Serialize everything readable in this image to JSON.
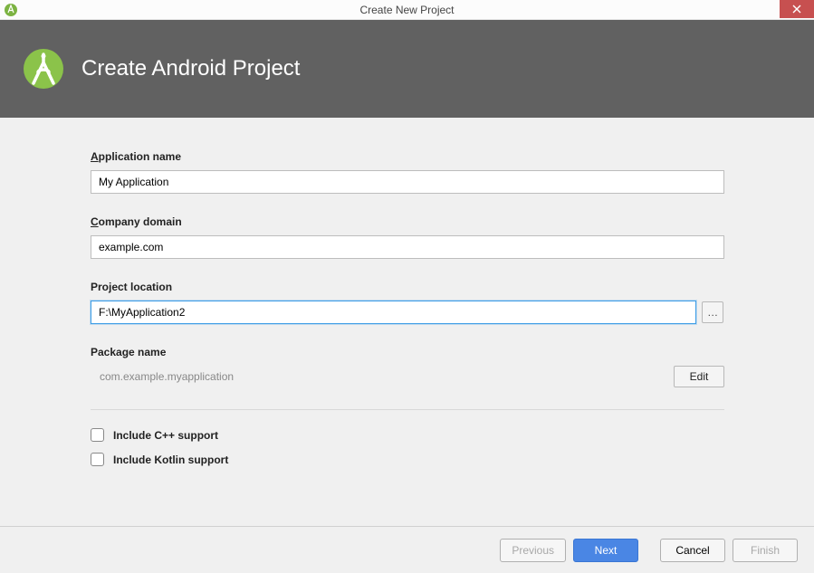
{
  "window": {
    "title": "Create New Project"
  },
  "header": {
    "title": "Create Android Project"
  },
  "fields": {
    "app_name_label": "pplication name",
    "app_name_accel": "A",
    "app_name_value": "My Application",
    "company_label": "ompany domain",
    "company_accel": "C",
    "company_value": "example.com",
    "project_loc_label": "Project location",
    "project_loc_value": "F:\\MyApplication2",
    "package_label": "Package name",
    "package_value": "com.example.myapplication",
    "edit_label": "Edit",
    "browse_label": "…"
  },
  "options": {
    "cpp_label": "Include C++ support",
    "kotlin_label": "Include Kotlin support"
  },
  "footer": {
    "previous": "Previous",
    "next": "Next",
    "cancel": "Cancel",
    "finish": "Finish"
  }
}
